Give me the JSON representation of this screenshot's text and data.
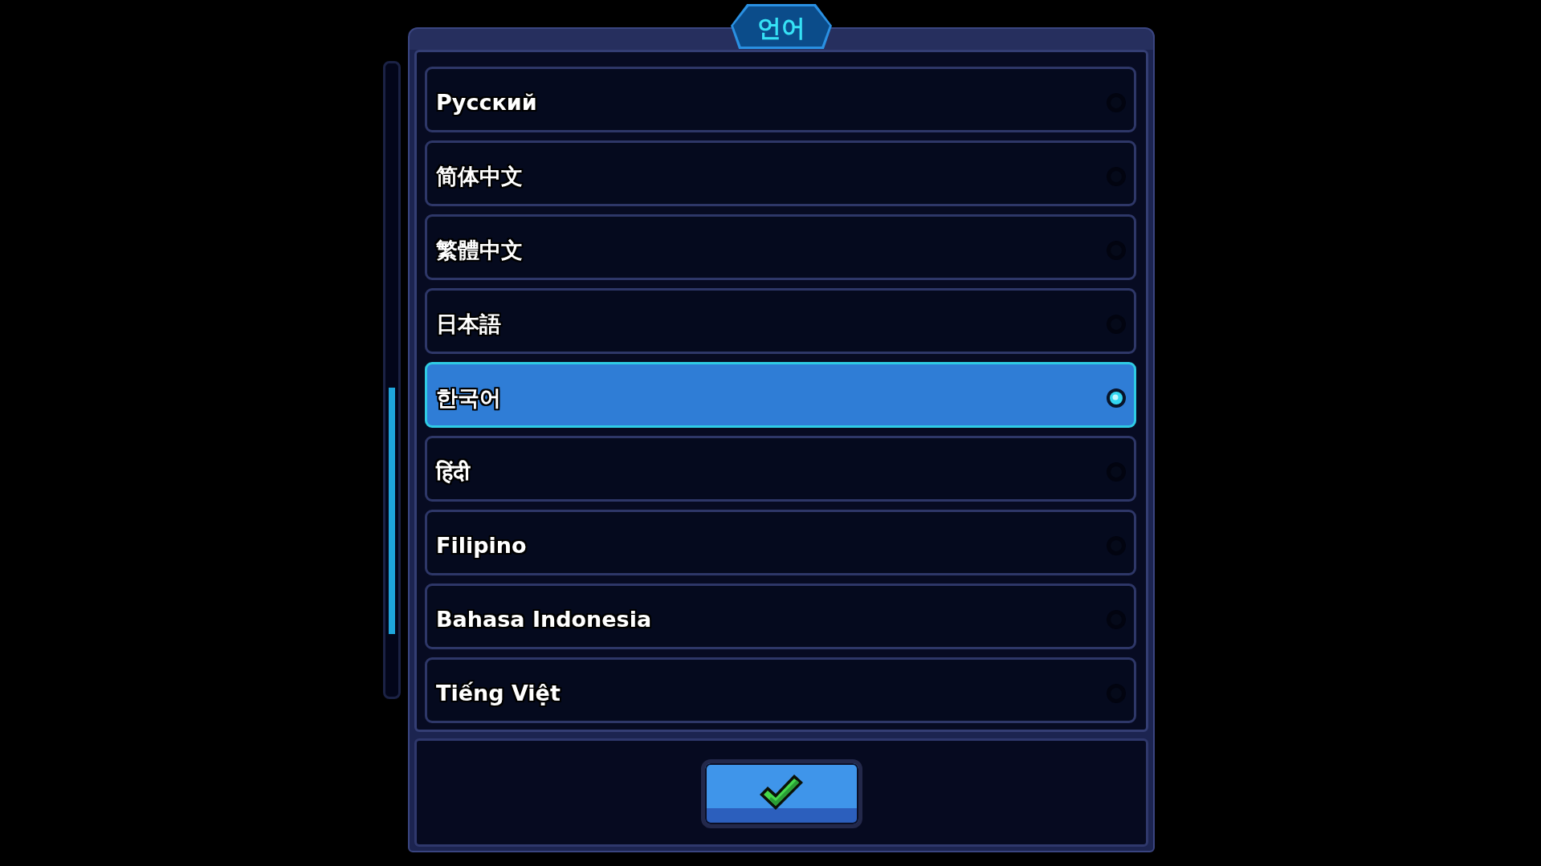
{
  "dialog": {
    "title": "언어"
  },
  "languages": [
    {
      "label": "Русский",
      "selected": false
    },
    {
      "label": "简体中文",
      "selected": false
    },
    {
      "label": "繁體中文",
      "selected": false
    },
    {
      "label": "日本語",
      "selected": false
    },
    {
      "label": "한국어",
      "selected": true
    },
    {
      "label": "हिंदी",
      "selected": false
    },
    {
      "label": "Filipino",
      "selected": false
    },
    {
      "label": "Bahasa Indonesia",
      "selected": false
    },
    {
      "label": "Tiếng Việt",
      "selected": false
    }
  ]
}
